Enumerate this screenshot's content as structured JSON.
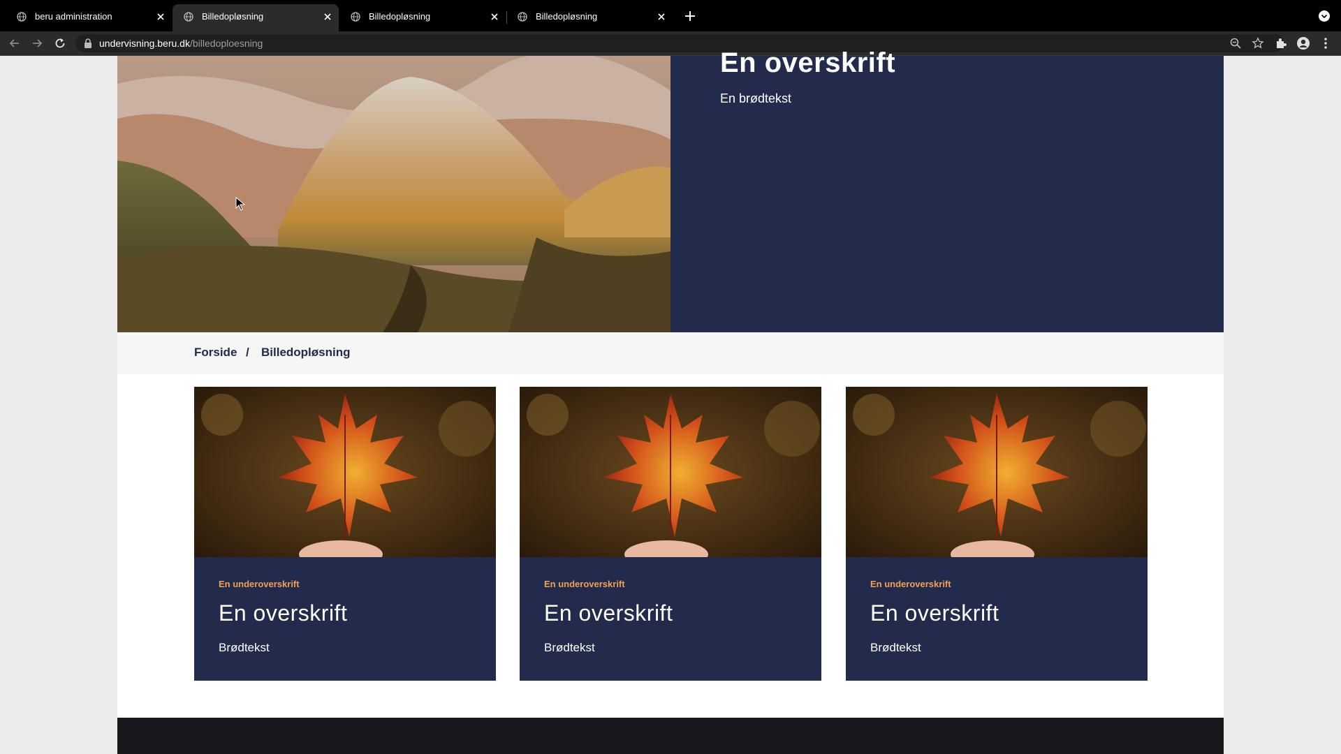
{
  "browser": {
    "tabs": [
      {
        "title": "beru administration",
        "active": false
      },
      {
        "title": "Billedopløsning",
        "active": true
      },
      {
        "title": "Billedopløsning",
        "active": false
      },
      {
        "title": "Billedopløsning",
        "active": false
      }
    ],
    "url_host": "undervisning.beru.dk",
    "url_path": "/billedoploesning"
  },
  "hero": {
    "title": "En overskrift",
    "text": "En brødtekst"
  },
  "breadcrumb": {
    "home": "Forside",
    "separator": "/",
    "current": "Billedopløsning"
  },
  "cards": [
    {
      "kicker": "En underoverskrift",
      "title": "En overskrift",
      "text": "Brødtekst"
    },
    {
      "kicker": "En underoverskrift",
      "title": "En overskrift",
      "text": "Brødtekst"
    },
    {
      "kicker": "En underoverskrift",
      "title": "En overskrift",
      "text": "Brødtekst"
    }
  ],
  "colors": {
    "navy": "#232b4d",
    "accent": "#f0a050",
    "footer": "#16181d"
  }
}
